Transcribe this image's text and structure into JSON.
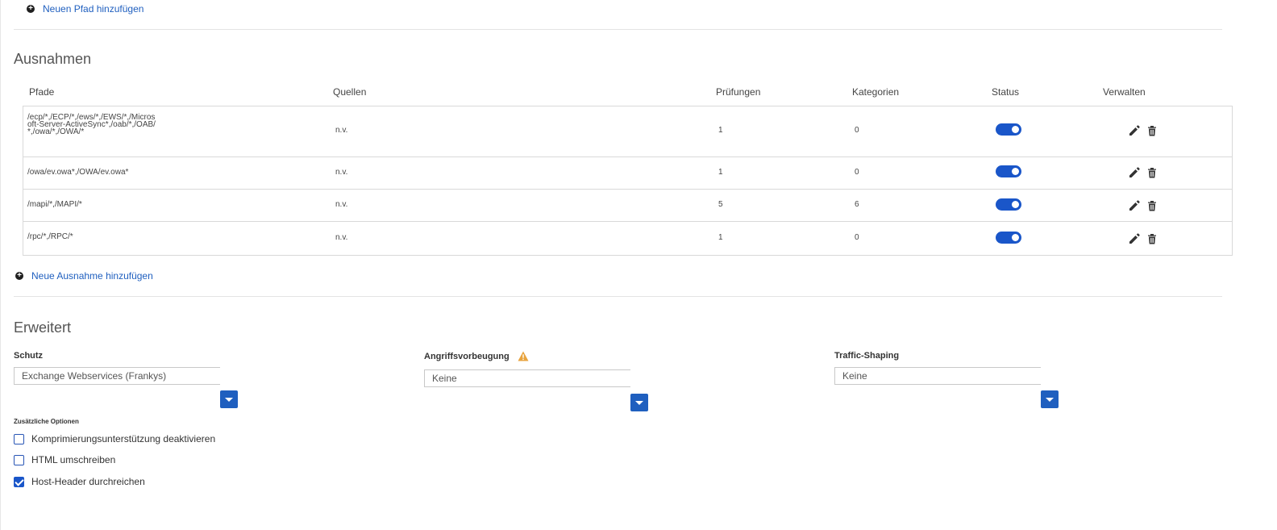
{
  "paths_section": {
    "add_path_label": "Neuen Pfad hinzufügen"
  },
  "exceptions": {
    "title": "Ausnahmen",
    "columns": {
      "paths": "Pfade",
      "sources": "Quellen",
      "checks": "Prüfungen",
      "categories": "Kategorien",
      "status": "Status",
      "manage": "Verwalten"
    },
    "rows": [
      {
        "paths": "/ecp/*,/ECP/*,/ews/*,/EWS/*,/Microsoft-Server-ActiveSync*,/oab/*,/OAB/*,/owa/*,/OWA/*",
        "sources": "n.v.",
        "checks": "1",
        "categories": "0",
        "enabled": true
      },
      {
        "paths": "/owa/ev.owa*,/OWA/ev.owa*",
        "sources": "n.v.",
        "checks": "1",
        "categories": "0",
        "enabled": true
      },
      {
        "paths": "/mapi/*,/MAPI/*",
        "sources": "n.v.",
        "checks": "5",
        "categories": "6",
        "enabled": true
      },
      {
        "paths": "/rpc/*,/RPC/*",
        "sources": "n.v.",
        "checks": "1",
        "categories": "0",
        "enabled": true
      }
    ],
    "add_exception_label": "Neue Ausnahme hinzufügen"
  },
  "advanced": {
    "title": "Erweitert",
    "protection": {
      "label": "Schutz",
      "value": "Exchange Webservices (Frankys)"
    },
    "attack_prevention": {
      "label": "Angriffsvorbeugung",
      "value": "Keine"
    },
    "traffic_shaping": {
      "label": "Traffic-Shaping",
      "value": "Keine"
    },
    "additional_options_label": "Zusätzliche Optionen",
    "options": [
      {
        "label": "Komprimierungsunterstützung deaktivieren",
        "checked": false
      },
      {
        "label": "HTML umschreiben",
        "checked": false
      },
      {
        "label": "Host-Header durchreichen",
        "checked": true
      }
    ]
  },
  "colors": {
    "accent": "#1a56c9",
    "link": "#1f5fbf",
    "warning": "#e8a33d"
  },
  "icons": {
    "add": "plus-circle-icon",
    "edit": "pencil-icon",
    "delete": "trash-icon",
    "warning": "warning-triangle-icon",
    "dropdown": "chevron-down-icon",
    "checkbox": "check-icon"
  }
}
